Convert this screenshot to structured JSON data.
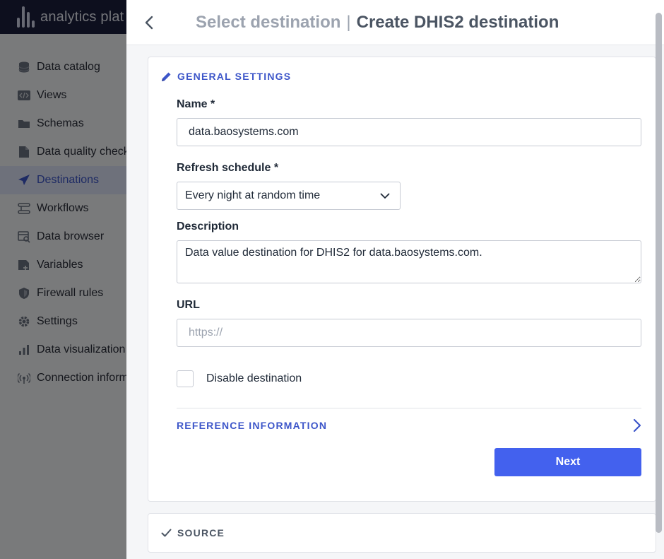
{
  "app": {
    "logo_text": "analytics plat",
    "sidebar": {
      "items": [
        {
          "label": "Data catalog",
          "icon": "database-icon",
          "active": false
        },
        {
          "label": "Views",
          "icon": "code-icon",
          "active": false
        },
        {
          "label": "Schemas",
          "icon": "folder-icon",
          "active": false
        },
        {
          "label": "Data quality check",
          "icon": "file-icon",
          "active": false
        },
        {
          "label": "Destinations",
          "icon": "send-icon",
          "active": true
        },
        {
          "label": "Workflows",
          "icon": "workflow-icon",
          "active": false
        },
        {
          "label": "Data browser",
          "icon": "browser-icon",
          "active": false
        },
        {
          "label": "Variables",
          "icon": "variables-icon",
          "active": false
        },
        {
          "label": "Firewall rules",
          "icon": "shield-icon",
          "active": false
        },
        {
          "label": "Settings",
          "icon": "gear-icon",
          "active": false
        },
        {
          "label": "Data visualization",
          "icon": "bar-chart-icon",
          "active": false
        },
        {
          "label": "Connection inform",
          "icon": "broadcast-icon",
          "active": false
        }
      ]
    },
    "active_color": "#3d56c9"
  },
  "drawer": {
    "breadcrumb_previous": "Select destination",
    "breadcrumb_separator": "|",
    "title": "Create DHIS2 destination",
    "general": {
      "heading": "General settings",
      "name_label": "Name *",
      "name_value": "data.baosystems.com",
      "refresh_label": "Refresh schedule *",
      "refresh_value": "Every night at random time",
      "description_label": "Description",
      "description_value": "Data value destination for DHIS2 for data.baosystems.com.",
      "url_label": "URL",
      "url_value": "",
      "url_placeholder": "https://",
      "disable_label": "Disable destination",
      "disable_checked": false,
      "reference_label": "Reference information",
      "next_label": "Next"
    },
    "source": {
      "heading": "Source"
    },
    "primary_color": "#4361ee"
  }
}
